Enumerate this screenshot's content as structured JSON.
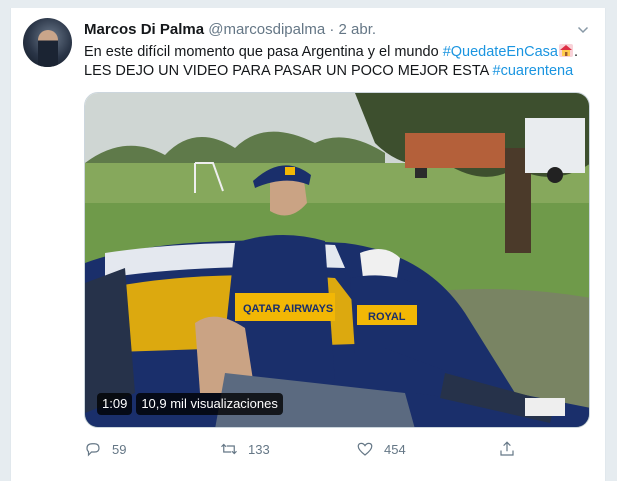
{
  "tweet": {
    "author_name": "Marcos Di Palma",
    "handle": "@marcosdipalma",
    "separator": "·",
    "time": "2 abr.",
    "text_part1": "En este difícil momento que pasa Argentina y el mundo ",
    "hashtag1": "#QuedateEnCasa",
    "text_part2": ".",
    "text_line2": "LES DEJO UN VIDEO PARA PASAR UN POCO MEJOR ESTA ",
    "hashtag2": "#cuarentena",
    "emoji": "house-with-garden"
  },
  "video": {
    "duration": "1:09",
    "views": "10,9 mil visualizaciones",
    "shirt_text": "QATAR AIRWAYS",
    "kid_shirt_text": "ROYAL"
  },
  "actions": {
    "replies": "59",
    "retweets": "133",
    "likes": "454"
  },
  "colors": {
    "link": "#1b95e0",
    "secondary_text": "#657786",
    "boca_blue": "#1a2f6b",
    "boca_gold": "#f2b705"
  }
}
